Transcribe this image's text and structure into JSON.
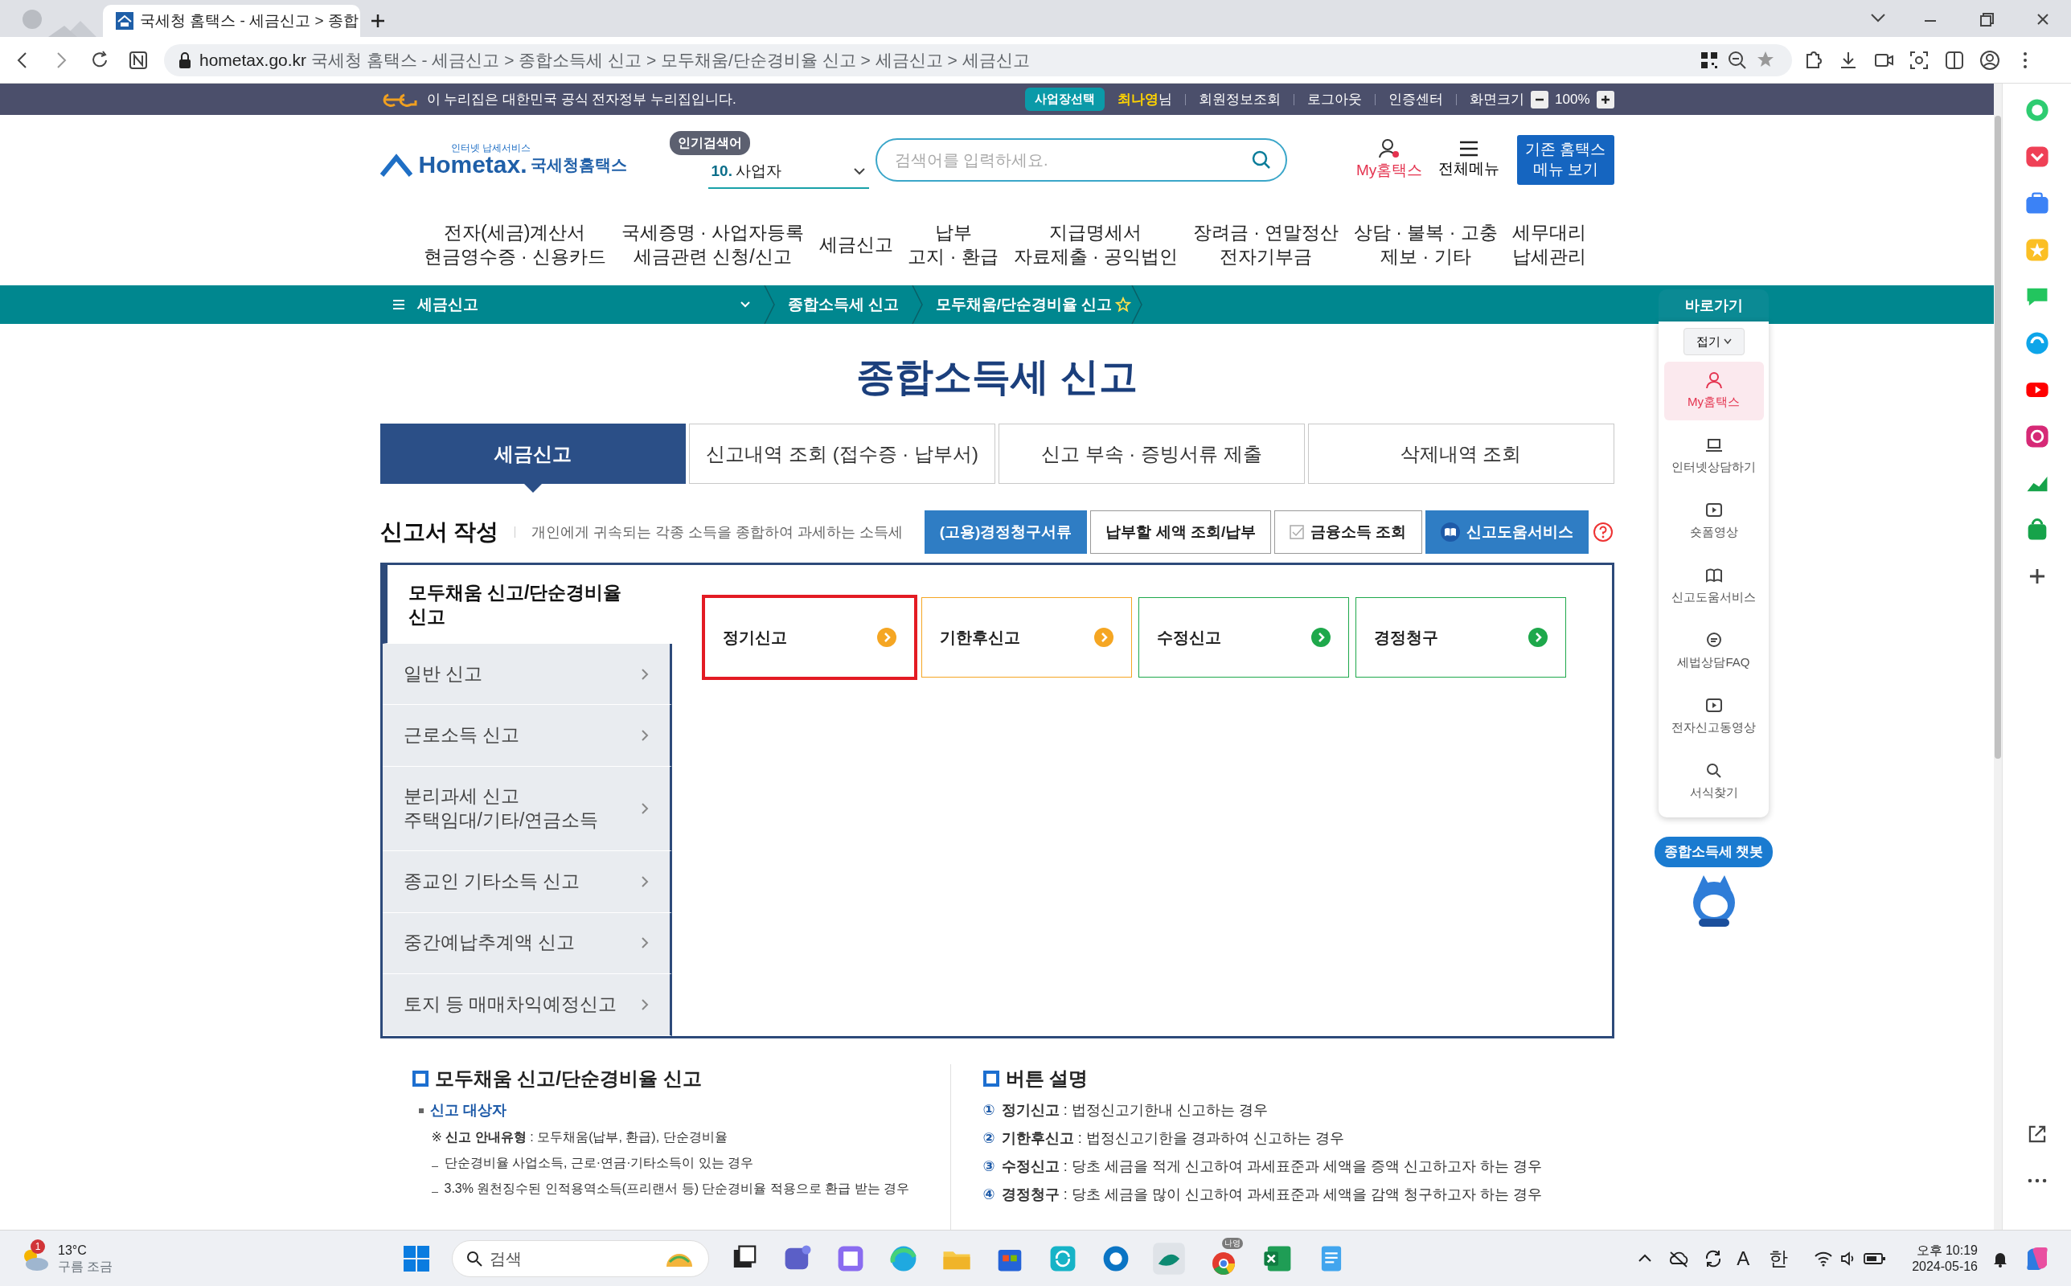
{
  "browser": {
    "tab_title": "국세청 홈택스 - 세금신고 > 종합",
    "url_host": "hometax.go.kr",
    "url_title": "국세청 홈택스 - 세금신고 > 종합소득세 신고 > 모두채움/단순경비율 신고 > 세금신고 > 세금신고"
  },
  "gov_banner": {
    "text": "이 누리집은 대한민국 공식 전자정부 누리집입니다."
  },
  "user_bar": {
    "business_button": "사업장선택",
    "user_name": "최나영",
    "honorific": "님",
    "links": [
      "회원정보조회",
      "로그아웃",
      "인증센터"
    ],
    "zoom_label": "화면크기",
    "zoom_value": "100%"
  },
  "header": {
    "logo_tagline": "인터넷 납세서비스",
    "logo_text": "Hometax.",
    "logo_korean": "국세청홈택스",
    "popular_label": "인기검색어",
    "popular_rank": "10.",
    "popular_term": "사업자",
    "search_placeholder": "검색어를 입력하세요.",
    "my_hometax": "My홈택스",
    "all_menu": "전체메뉴",
    "old_menu": [
      "기존 홈택스",
      "메뉴 보기"
    ]
  },
  "main_nav": [
    [
      "전자(세금)계산서",
      "현금영수증 · 신용카드"
    ],
    [
      "국세증명 · 사업자등록",
      "세금관련 신청/신고"
    ],
    [
      "세금신고"
    ],
    [
      "납부",
      "고지 · 환급"
    ],
    [
      "지급명세서",
      "자료제출 · 공익법인"
    ],
    [
      "장려금 · 연말정산",
      "전자기부금"
    ],
    [
      "상담 · 불복 · 고충",
      "제보 · 기타"
    ],
    [
      "세무대리",
      "납세관리"
    ]
  ],
  "breadcrumb": {
    "menu": "세금신고",
    "items": [
      "종합소득세 신고",
      "모두채움/단순경비율 신고"
    ]
  },
  "page_title": "종합소득세 신고",
  "tabs": [
    {
      "label": "세금신고",
      "selected": true
    },
    {
      "label": "신고내역 조회 (접수증 · 납부서)",
      "selected": false
    },
    {
      "label": "신고 부속 · 증빙서류 제출",
      "selected": false
    },
    {
      "label": "삭제내역 조회",
      "selected": false
    }
  ],
  "section": {
    "title": "신고서 작성",
    "description": "개인에게 귀속되는 각종 소득을 종합하여 과세하는 소득세",
    "buttons": [
      {
        "label": "(고용)경정청구서류",
        "kind": "primary"
      },
      {
        "label": "납부할 세액 조회/납부",
        "kind": "outline"
      },
      {
        "label": "금융소득 조회",
        "kind": "check"
      },
      {
        "label": "신고도움서비스",
        "kind": "book"
      }
    ]
  },
  "side_menu": [
    {
      "label": "모두채움 신고/단순경비율\n신고",
      "selected": true
    },
    {
      "label": "일반 신고",
      "selected": false
    },
    {
      "label": "근로소득 신고",
      "selected": false
    },
    {
      "label": "분리과세 신고\n주택임대/기타/연금소득",
      "selected": false
    },
    {
      "label": "종교인 기타소득 신고",
      "selected": false
    },
    {
      "label": "중간예납추계액 신고",
      "selected": false
    },
    {
      "label": "토지 등 매매차익예정신고",
      "selected": false
    }
  ],
  "filing_cards": [
    {
      "label": "정기신고",
      "color": "#f5a623",
      "selected": true
    },
    {
      "label": "기한후신고",
      "color": "#f5a623",
      "selected": false
    },
    {
      "label": "수정신고",
      "color": "#1ea84b",
      "selected": false
    },
    {
      "label": "경정청구",
      "color": "#1ea84b",
      "selected": false
    }
  ],
  "info_left": {
    "title": "모두채움 신고/단순경비율 신고",
    "subtitle": "신고 대상자",
    "lines": [
      {
        "kind": "note",
        "text": "※ **신고 안내유형** : 모두채움(납부, 환급), 단순경비율"
      },
      {
        "kind": "dash",
        "text": "단순경비율 사업소득, 근로·연금·기타소득이 있는 경우"
      },
      {
        "kind": "dash",
        "text": "3.3% 원천징수된 인적용역소득(프리랜서 등) 단순경비율 적용으로 환급 받는 경우"
      }
    ]
  },
  "info_right": {
    "title": "버튼 설명",
    "items": [
      {
        "number": "①",
        "text": "**정기신고** : 법정신고기한내 신고하는 경우"
      },
      {
        "number": "②",
        "text": "**기한후신고** : 법정신고기한을 경과하여 신고하는 경우"
      },
      {
        "number": "③",
        "text": "**수정신고** : 당초 세금을 적게 신고하여 과세표준과 세액을 증액 신고하고자 하는 경우"
      },
      {
        "number": "④",
        "text": "**경정청구** : 당초 세금을 많이 신고하여 과세표준과 세액을 감액 청구하고자 하는 경우"
      }
    ]
  },
  "quick_menu": {
    "title": "바로가기",
    "collapse": "접기",
    "items": [
      {
        "label": "My홈택스",
        "kind": "person",
        "selected": true
      },
      {
        "label": "인터넷상담하기",
        "kind": "laptop",
        "selected": false
      },
      {
        "label": "숏폼영상",
        "kind": "video",
        "selected": false
      },
      {
        "label": "신고도움서비스",
        "kind": "book",
        "selected": false
      },
      {
        "label": "세법상담FAQ",
        "kind": "chat",
        "selected": false
      },
      {
        "label": "전자신고동영상",
        "kind": "video",
        "selected": false
      },
      {
        "label": "서식찾기",
        "kind": "search",
        "selected": false
      }
    ]
  },
  "chatbot": {
    "label": "종합소득세 챗봇"
  },
  "taskbar": {
    "weather_badge": "1",
    "temperature": "13°C",
    "weather": "구름 조금",
    "search": "검색",
    "chrome_badge": "나영",
    "ime": "A",
    "language": "한",
    "time": "오후 10:19",
    "date": "2024-05-16"
  }
}
